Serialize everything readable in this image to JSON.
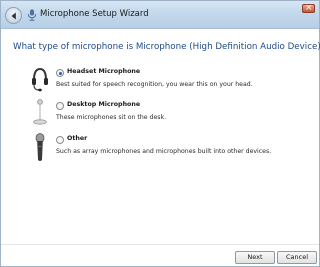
{
  "window": {
    "title": "Microphone Setup Wizard"
  },
  "heading": "What type of microphone is Microphone (High Definition Audio Device)?",
  "options": [
    {
      "label": "Headset Microphone",
      "description": "Best suited for speech recognition, you wear this on your head.",
      "selected": true,
      "icon": "headset-icon"
    },
    {
      "label": "Desktop Microphone",
      "description": "These microphones sit on the desk.",
      "selected": false,
      "icon": "desktop-microphone-icon"
    },
    {
      "label": "Other",
      "description": "Such as array microphones and microphones built into other devices.",
      "selected": false,
      "icon": "handheld-microphone-icon"
    }
  ],
  "buttons": {
    "next": "Next",
    "cancel": "Cancel"
  },
  "colors": {
    "heading": "#1f4a8a",
    "titlebar": "#c3d8ec",
    "radio_selected": "#1d5fb0"
  }
}
